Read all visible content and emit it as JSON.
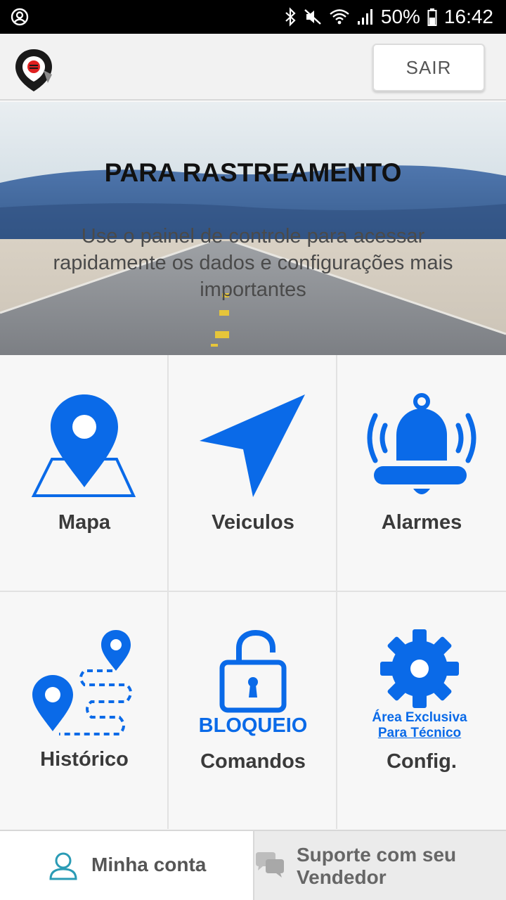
{
  "status_bar": {
    "battery": "50%",
    "time": "16:42"
  },
  "header": {
    "logout_label": "SAIR"
  },
  "banner": {
    "title": "PARA RASTREAMENTO",
    "subtitle": "Use o painel de controle para acessar rapidamente os dados e configurações mais importantes"
  },
  "tiles": {
    "mapa": "Mapa",
    "veiculos": "Veiculos",
    "alarmes": "Alarmes",
    "historico": "Histórico",
    "comandos": "Comandos",
    "comandos_caption": "BLOQUEIO",
    "config": "Config.",
    "config_caption_1": "Área Exclusiva",
    "config_caption_2": "Para Técnico"
  },
  "bottom": {
    "account": "Minha conta",
    "support": "Suporte com seu Vendedor"
  },
  "colors": {
    "accent": "#0a6ae8",
    "logo_red": "#e02020"
  }
}
